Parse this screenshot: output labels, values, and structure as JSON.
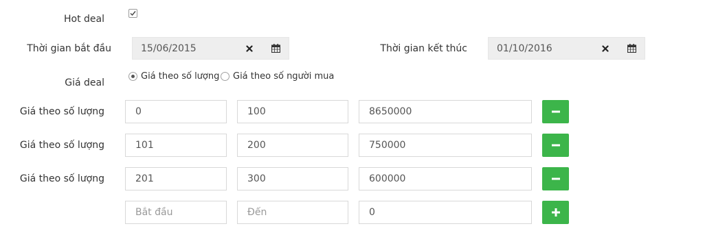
{
  "hot_deal": {
    "label": "Hot deal",
    "checked": true
  },
  "start_time": {
    "label": "Thời gian bắt đầu",
    "value": "15/06/2015"
  },
  "end_time": {
    "label": "Thời gian kết thúc",
    "value": "01/10/2016"
  },
  "deal_price": {
    "label": "Giá deal",
    "options": [
      {
        "label": "Giá theo số lượng",
        "selected": true
      },
      {
        "label": "Giá theo số người mua",
        "selected": false
      }
    ]
  },
  "price_rows": [
    {
      "label": "Giá theo số lượng",
      "from": "0",
      "to": "100",
      "price": "8650000"
    },
    {
      "label": "Giá theo số lượng",
      "from": "101",
      "to": "200",
      "price": "750000"
    },
    {
      "label": "Giá theo số lượng",
      "from": "201",
      "to": "300",
      "price": "600000"
    }
  ],
  "new_row": {
    "from_placeholder": "Bắt đầu",
    "to_placeholder": "Đến",
    "price": "0"
  },
  "colors": {
    "button_green": "#3cb54a",
    "date_bg": "#eeeeee"
  },
  "icons": {
    "clear": "times-icon",
    "calendar": "calendar-icon",
    "remove": "minus-icon",
    "add": "plus-icon"
  }
}
